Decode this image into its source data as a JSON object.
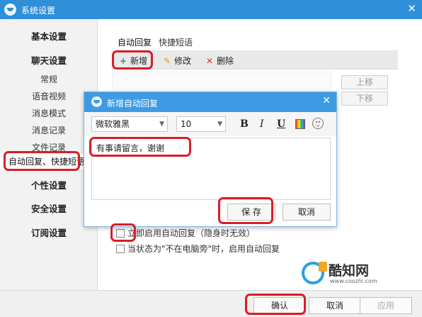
{
  "window": {
    "title": "系统设置",
    "close_glyph": "✕"
  },
  "sidebar": {
    "items": [
      {
        "label": "基本设置"
      },
      {
        "label": "聊天设置"
      },
      {
        "label": "常规"
      },
      {
        "label": "语音视频"
      },
      {
        "label": "消息模式"
      },
      {
        "label": "消息记录"
      },
      {
        "label": "文件记录"
      },
      {
        "label": "自动回复、快捷短语"
      },
      {
        "label": "个性设置"
      },
      {
        "label": "安全设置"
      },
      {
        "label": "订阅设置"
      }
    ]
  },
  "tabs": [
    {
      "label": "自动回复"
    },
    {
      "label": "快捷短语"
    }
  ],
  "toolbar": {
    "add": {
      "icon": "plus-icon",
      "glyph": "+",
      "label": "新增"
    },
    "edit": {
      "icon": "pencil-icon",
      "glyph": "✎",
      "label": "修改"
    },
    "delete": {
      "icon": "delete-x-icon",
      "glyph": "✕",
      "label": "删除"
    }
  },
  "side_buttons": {
    "move_up": "上移",
    "move_down": "下移"
  },
  "options": {
    "enable_auto_reply": "立即启用自动回复（隐身时无效）",
    "away_auto_reply": "当状态为\"不在电脑旁\"时，启用自动回复"
  },
  "footer": {
    "confirm": "确认",
    "cancel": "取消",
    "apply": "应用"
  },
  "dialog": {
    "title": "新增自动回复",
    "close_glyph": "✕",
    "font_family_value": "微软雅黑",
    "font_size_value": "10",
    "format": {
      "bold": "B",
      "italic": "I",
      "underline": "U"
    },
    "text_value": "有事请留言，谢谢",
    "save": "保 存",
    "cancel": "取消"
  },
  "watermark": {
    "name": "酷知网",
    "url": "www.coozhi.com"
  },
  "colors": {
    "titlebar": "#2f8fd8",
    "dialog_title": "#3d9be3",
    "highlight": "#d81e28",
    "add_icon": "#2ea043"
  }
}
